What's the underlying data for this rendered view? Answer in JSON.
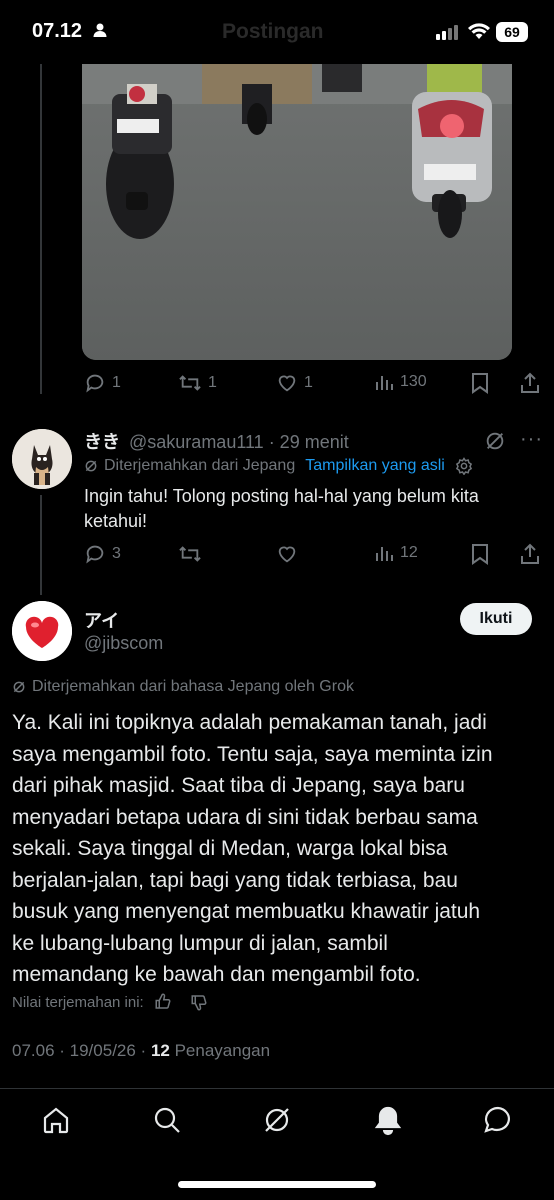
{
  "status_bar": {
    "time": "07.12",
    "header_ghost": "Postingan",
    "battery": "69"
  },
  "reply_bar": {
    "replies": "1",
    "reposts": "1",
    "likes": "1",
    "views": "130"
  },
  "comment": {
    "display_name": "きき",
    "handle_time": "@sakuramau111 · 29 menit",
    "translated_label": "Diterjemahkan dari Jepang",
    "show_original": "Tampilkan yang asli",
    "text": "Ingin tahu! Tolong posting hal-hal yang belum kita ketahui!",
    "replies": "3",
    "views": "12"
  },
  "reply": {
    "display_name": "アイ",
    "handle": "@jibscom",
    "follow_label": "Ikuti",
    "translated_label": "Diterjemahkan dari bahasa Jepang oleh Grok",
    "text_lines": [
      "Ya. Kali ini topiknya adalah pemakaman tanah, jadi",
      "saya mengambil foto. Tentu saja, saya meminta izin",
      "dari pihak masjid. Saat tiba di Jepang, saya baru",
      "menyadari betapa udara di sini tidak berbau sama",
      "sekali. Saya tinggal di Medan, warga lokal bisa",
      "berjalan-jalan, tapi bagi yang tidak terbiasa, bau",
      "busuk yang menyengat membuatku khawatir jatuh",
      "ke lubang-lubang lumpur di jalan, sambil",
      "memandang ke bawah dan mengambil foto."
    ],
    "rate_label": "Nilai terjemahan ini:",
    "timestamp": "07.06 · 19/05/26 · ",
    "views_count": "12",
    "views_label": " Penayangan"
  },
  "icons": {
    "tabs": [
      "home-icon",
      "search-icon",
      "grok-icon",
      "notifications-icon",
      "messages-icon"
    ]
  },
  "colors": {
    "background": "#000000",
    "text": "#e7e9ea",
    "muted": "#71767b",
    "link": "#1d9bf0"
  }
}
